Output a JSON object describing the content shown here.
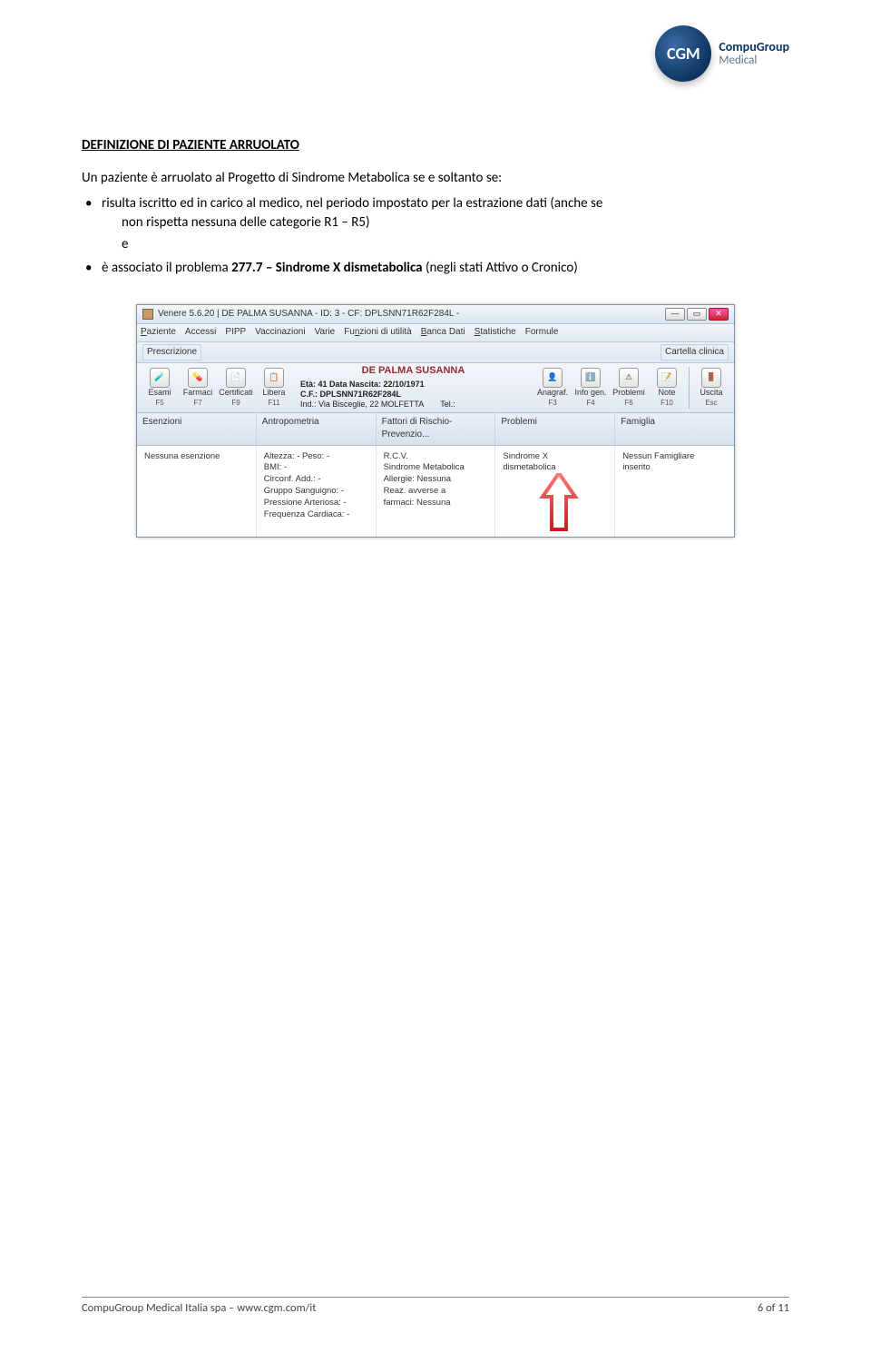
{
  "logo": {
    "badge": "CGM",
    "line1": "CompuGroup",
    "line2": "Medical"
  },
  "doc": {
    "heading": "DEFINIZIONE DI PAZIENTE ARRUOLATO",
    "intro": "Un paziente è arruolato al Progetto di Sindrome Metabolica se e soltanto se:",
    "bul1a": "risulta iscritto ed in carico al medico, nel periodo impostato per la estrazione dati (anche se",
    "bul1b": "non rispetta nessuna delle categorie R1 – R5)",
    "bul1c": "e",
    "bul2a": "è associato il problema ",
    "bul2b": "277.7 – Sindrome X dismetabolica",
    "bul2c": " (negli stati Attivo o Cronico)"
  },
  "app": {
    "title": "Venere 5.6.20   |   DE PALMA SUSANNA  -  ID:  3  -  CF: DPLSNN71R62F284L -",
    "menu": [
      "Paziente",
      "Accessi",
      "PIPP",
      "Vaccinazioni",
      "Varie",
      "Funzioni di utilità",
      "Banca Dati",
      "Statistiche",
      "Formule"
    ],
    "grp_left": "Prescrizione",
    "grp_right": "Cartella clinica",
    "left_buttons": [
      {
        "label": "Esami",
        "key": "F5"
      },
      {
        "label": "Farmaci",
        "key": "F7"
      },
      {
        "label": "Certificati",
        "key": "F9"
      },
      {
        "label": "Libera",
        "key": "F11"
      }
    ],
    "patient": {
      "name": "DE PALMA SUSANNA",
      "eta": "Età: 41 Data Nascita: 22/10/1971",
      "cf": "C.F.: DPLSNN71R62F284L",
      "ind": "Ind.: Via Bisceglie, 22 MOLFETTA",
      "tel": "Tel.:"
    },
    "right_buttons": [
      {
        "label": "Anagraf.",
        "key": "F3"
      },
      {
        "label": "Info gen.",
        "key": "F4"
      },
      {
        "label": "Problemi",
        "key": "F6"
      },
      {
        "label": "Note",
        "key": "F10"
      }
    ],
    "exit_button": {
      "label": "Uscita",
      "key": "Esc"
    },
    "tabs": [
      "Esenzioni",
      "Antropometria",
      "Fattori di Rischio-Prevenzio...",
      "Problemi",
      "Famiglia"
    ],
    "col_esenzioni": "Nessuna esenzione",
    "col_antro": [
      "Altezza: -   Peso: -",
      "BMI: -",
      "Circonf. Add.: -",
      "Gruppo Sanguigno: -",
      "Pressione Arteriosa: -",
      "Frequenza Cardiaca: -"
    ],
    "col_fattori": [
      "R.C.V.",
      "Sindrome Metabolica",
      "Allergie: Nessuna",
      "Reaz. avverse a",
      "farmaci: Nessuna"
    ],
    "col_problemi": [
      "Sindrome X",
      "dismetabolica"
    ],
    "col_famiglia": [
      "Nessun Famigliare",
      "inserito"
    ]
  },
  "footer": {
    "left": "CompuGroup Medical Italia spa – www.cgm.com/it",
    "right": "6 of 11"
  }
}
